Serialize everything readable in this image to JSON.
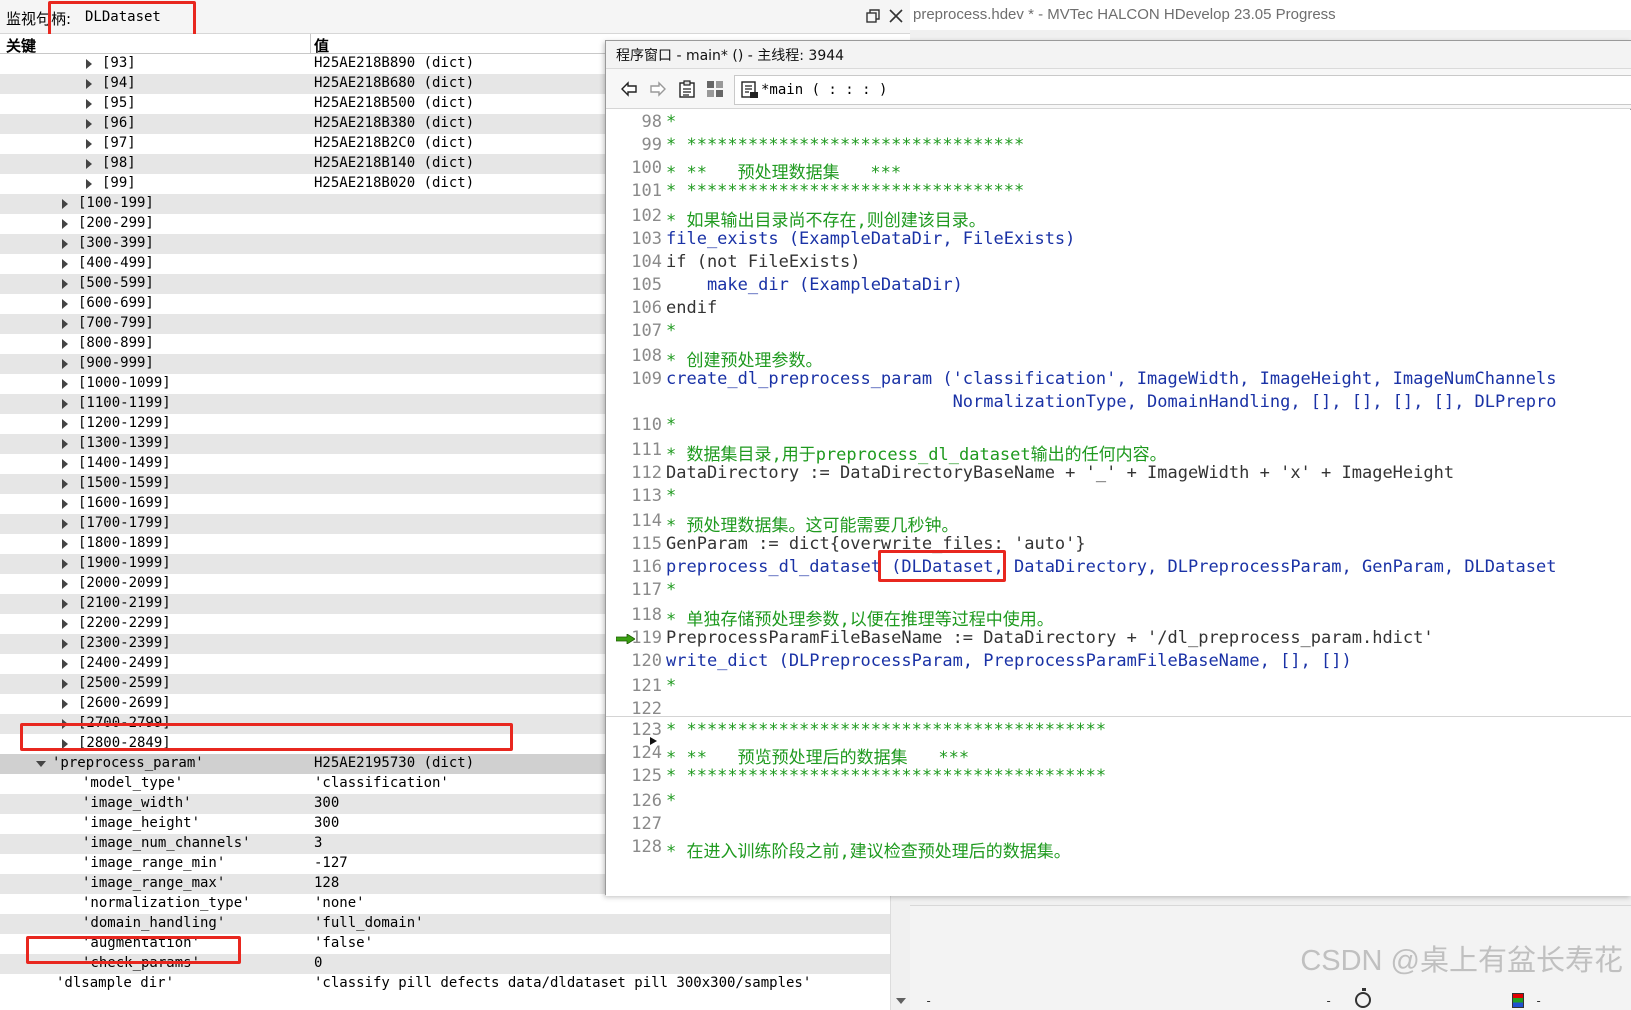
{
  "main_window": {
    "title": "preprocess.hdev * - MVTec HALCON HDevelop 23.05 Progress",
    "bottom_dash_1": "-",
    "bottom_dash_2": "-",
    "bottom_dash_3": "-"
  },
  "watermark": "CSDN @桌上有盆长寿花",
  "inspect": {
    "title_prefix": "监视句柄:",
    "title_name": "DLDataset",
    "col_key": "关键",
    "col_value": "值",
    "rows": [
      {
        "key": "[93]",
        "value": "H25AE218B890 (dict)",
        "arrow": "right",
        "indent": 2
      },
      {
        "key": "[94]",
        "value": "H25AE218B680 (dict)",
        "arrow": "right",
        "indent": 2
      },
      {
        "key": "[95]",
        "value": "H25AE218B500 (dict)",
        "arrow": "right",
        "indent": 2
      },
      {
        "key": "[96]",
        "value": "H25AE218B380 (dict)",
        "arrow": "right",
        "indent": 2
      },
      {
        "key": "[97]",
        "value": "H25AE218B2C0 (dict)",
        "arrow": "right",
        "indent": 2
      },
      {
        "key": "[98]",
        "value": "H25AE218B140 (dict)",
        "arrow": "right",
        "indent": 2
      },
      {
        "key": "[99]",
        "value": "H25AE218B020 (dict)",
        "arrow": "right",
        "indent": 2
      },
      {
        "key": "[100-199]",
        "value": "",
        "arrow": "right",
        "indent": 1
      },
      {
        "key": "[200-299]",
        "value": "",
        "arrow": "right",
        "indent": 1
      },
      {
        "key": "[300-399]",
        "value": "",
        "arrow": "right",
        "indent": 1
      },
      {
        "key": "[400-499]",
        "value": "",
        "arrow": "right",
        "indent": 1
      },
      {
        "key": "[500-599]",
        "value": "",
        "arrow": "right",
        "indent": 1
      },
      {
        "key": "[600-699]",
        "value": "",
        "arrow": "right",
        "indent": 1
      },
      {
        "key": "[700-799]",
        "value": "",
        "arrow": "right",
        "indent": 1
      },
      {
        "key": "[800-899]",
        "value": "",
        "arrow": "right",
        "indent": 1
      },
      {
        "key": "[900-999]",
        "value": "",
        "arrow": "right",
        "indent": 1
      },
      {
        "key": "[1000-1099]",
        "value": "",
        "arrow": "right",
        "indent": 1
      },
      {
        "key": "[1100-1199]",
        "value": "",
        "arrow": "right",
        "indent": 1
      },
      {
        "key": "[1200-1299]",
        "value": "",
        "arrow": "right",
        "indent": 1
      },
      {
        "key": "[1300-1399]",
        "value": "",
        "arrow": "right",
        "indent": 1
      },
      {
        "key": "[1400-1499]",
        "value": "",
        "arrow": "right",
        "indent": 1
      },
      {
        "key": "[1500-1599]",
        "value": "",
        "arrow": "right",
        "indent": 1
      },
      {
        "key": "[1600-1699]",
        "value": "",
        "arrow": "right",
        "indent": 1
      },
      {
        "key": "[1700-1799]",
        "value": "",
        "arrow": "right",
        "indent": 1
      },
      {
        "key": "[1800-1899]",
        "value": "",
        "arrow": "right",
        "indent": 1
      },
      {
        "key": "[1900-1999]",
        "value": "",
        "arrow": "right",
        "indent": 1
      },
      {
        "key": "[2000-2099]",
        "value": "",
        "arrow": "right",
        "indent": 1
      },
      {
        "key": "[2100-2199]",
        "value": "",
        "arrow": "right",
        "indent": 1
      },
      {
        "key": "[2200-2299]",
        "value": "",
        "arrow": "right",
        "indent": 1
      },
      {
        "key": "[2300-2399]",
        "value": "",
        "arrow": "right",
        "indent": 1
      },
      {
        "key": "[2400-2499]",
        "value": "",
        "arrow": "right",
        "indent": 1
      },
      {
        "key": "[2500-2599]",
        "value": "",
        "arrow": "right",
        "indent": 1
      },
      {
        "key": "[2600-2699]",
        "value": "",
        "arrow": "right",
        "indent": 1
      },
      {
        "key": "[2700-2799]",
        "value": "",
        "arrow": "right",
        "indent": 1
      },
      {
        "key": "[2800-2849]",
        "value": "",
        "arrow": "right",
        "indent": 1
      },
      {
        "key": "'preprocess_param'",
        "value": "H25AE2195730 (dict)",
        "arrow": "down",
        "indent": 0
      },
      {
        "key": "'model_type'",
        "value": "'classification'",
        "arrow": "none",
        "indent": 1
      },
      {
        "key": "'image_width'",
        "value": "300",
        "arrow": "none",
        "indent": 1
      },
      {
        "key": "'image_height'",
        "value": "300",
        "arrow": "none",
        "indent": 1
      },
      {
        "key": "'image_num_channels'",
        "value": "3",
        "arrow": "none",
        "indent": 1
      },
      {
        "key": "'image_range_min'",
        "value": "-127",
        "arrow": "none",
        "indent": 1
      },
      {
        "key": "'image_range_max'",
        "value": "128",
        "arrow": "none",
        "indent": 1
      },
      {
        "key": "'normalization_type'",
        "value": "'none'",
        "arrow": "none",
        "indent": 1
      },
      {
        "key": "'domain_handling'",
        "value": "'full_domain'",
        "arrow": "none",
        "indent": 1
      },
      {
        "key": "'augmentation'",
        "value": "'false'",
        "arrow": "none",
        "indent": 1
      },
      {
        "key": "'check_params'",
        "value": "0",
        "arrow": "none",
        "indent": 1
      },
      {
        "key": "'dlsample_dir'",
        "value": "'classify_pill_defects_data/dldataset_pill_300x300/samples'",
        "arrow": "none",
        "indent": 0
      }
    ]
  },
  "program": {
    "title": "程序窗口 - main* () - 主线程: 3944",
    "procedure": "*main ( : : : )",
    "lines": [
      {
        "n": "98",
        "text": "*",
        "kind": "comment"
      },
      {
        "n": "99",
        "text": "* *********************************",
        "kind": "comment"
      },
      {
        "n": "100",
        "text": "* **   预处理数据集   ***",
        "kind": "comment"
      },
      {
        "n": "101",
        "text": "* *********************************",
        "kind": "comment"
      },
      {
        "n": "102",
        "text": "* 如果输出目录尚不存在,则创建该目录。",
        "kind": "comment"
      },
      {
        "n": "103",
        "text": "file_exists (ExampleDataDir, FileExists)",
        "kind": "op"
      },
      {
        "n": "104",
        "text": "if (not FileExists)",
        "kind": "kw"
      },
      {
        "n": "105",
        "text": "    make_dir (ExampleDataDir)",
        "kind": "op"
      },
      {
        "n": "106",
        "text": "endif",
        "kind": "kw"
      },
      {
        "n": "107",
        "text": "*",
        "kind": "comment"
      },
      {
        "n": "108",
        "text": "* 创建预处理参数。",
        "kind": "comment"
      },
      {
        "n": "109",
        "text": "create_dl_preprocess_param ('classification', ImageWidth, ImageHeight, ImageNumChannels",
        "kind": "op"
      },
      {
        "n": "",
        "text": "                            NormalizationType, DomainHandling, [], [], [], [], DLPrepro",
        "kind": "op"
      },
      {
        "n": "110",
        "text": "*",
        "kind": "comment"
      },
      {
        "n": "111",
        "text": "* 数据集目录,用于preprocess_dl_dataset输出的任何内容。",
        "kind": "comment"
      },
      {
        "n": "112",
        "text": "DataDirectory := DataDirectoryBaseName + '_' + ImageWidth + 'x' + ImageHeight",
        "kind": "plain"
      },
      {
        "n": "113",
        "text": "*",
        "kind": "comment"
      },
      {
        "n": "114",
        "text": "* 预处理数据集。这可能需要几秒钟。",
        "kind": "comment"
      },
      {
        "n": "115",
        "text": "GenParam := dict{overwrite_files: 'auto'}",
        "kind": "plain"
      },
      {
        "n": "116",
        "text": "preprocess_dl_dataset (DLDataset, DataDirectory, DLPreprocessParam, GenParam, DLDataset",
        "kind": "op"
      },
      {
        "n": "117",
        "text": "*",
        "kind": "comment"
      },
      {
        "n": "118",
        "text": "* 单独存储预处理参数,以便在推理等过程中使用。",
        "kind": "comment"
      },
      {
        "n": "119",
        "text": "PreprocessParamFileBaseName := DataDirectory + '/dl_preprocess_param.hdict'",
        "kind": "plain",
        "pc": true
      },
      {
        "n": "120",
        "text": "write_dict (DLPreprocessParam, PreprocessParamFileBaseName, [], [])",
        "kind": "op"
      },
      {
        "n": "121",
        "text": "*",
        "kind": "comment"
      },
      {
        "n": "122",
        "text": "",
        "kind": "plain"
      },
      {
        "n": "123",
        "text": "* *****************************************",
        "kind": "comment"
      },
      {
        "n": "124",
        "text": "* **   预览预处理后的数据集   ***",
        "kind": "comment",
        "ins": true
      },
      {
        "n": "125",
        "text": "* *****************************************",
        "kind": "comment"
      },
      {
        "n": "126",
        "text": "*",
        "kind": "comment"
      },
      {
        "n": "127",
        "text": "",
        "kind": "plain"
      },
      {
        "n": "128",
        "text": "* 在进入训练阶段之前,建议检查预处理后的数据集。",
        "kind": "comment"
      }
    ]
  },
  "colors": {
    "highlight_red": "#e8271f",
    "comment_green": "#1f9a1f",
    "operator_blue": "#1a32a6",
    "row_alt": "#e6e6e6"
  }
}
